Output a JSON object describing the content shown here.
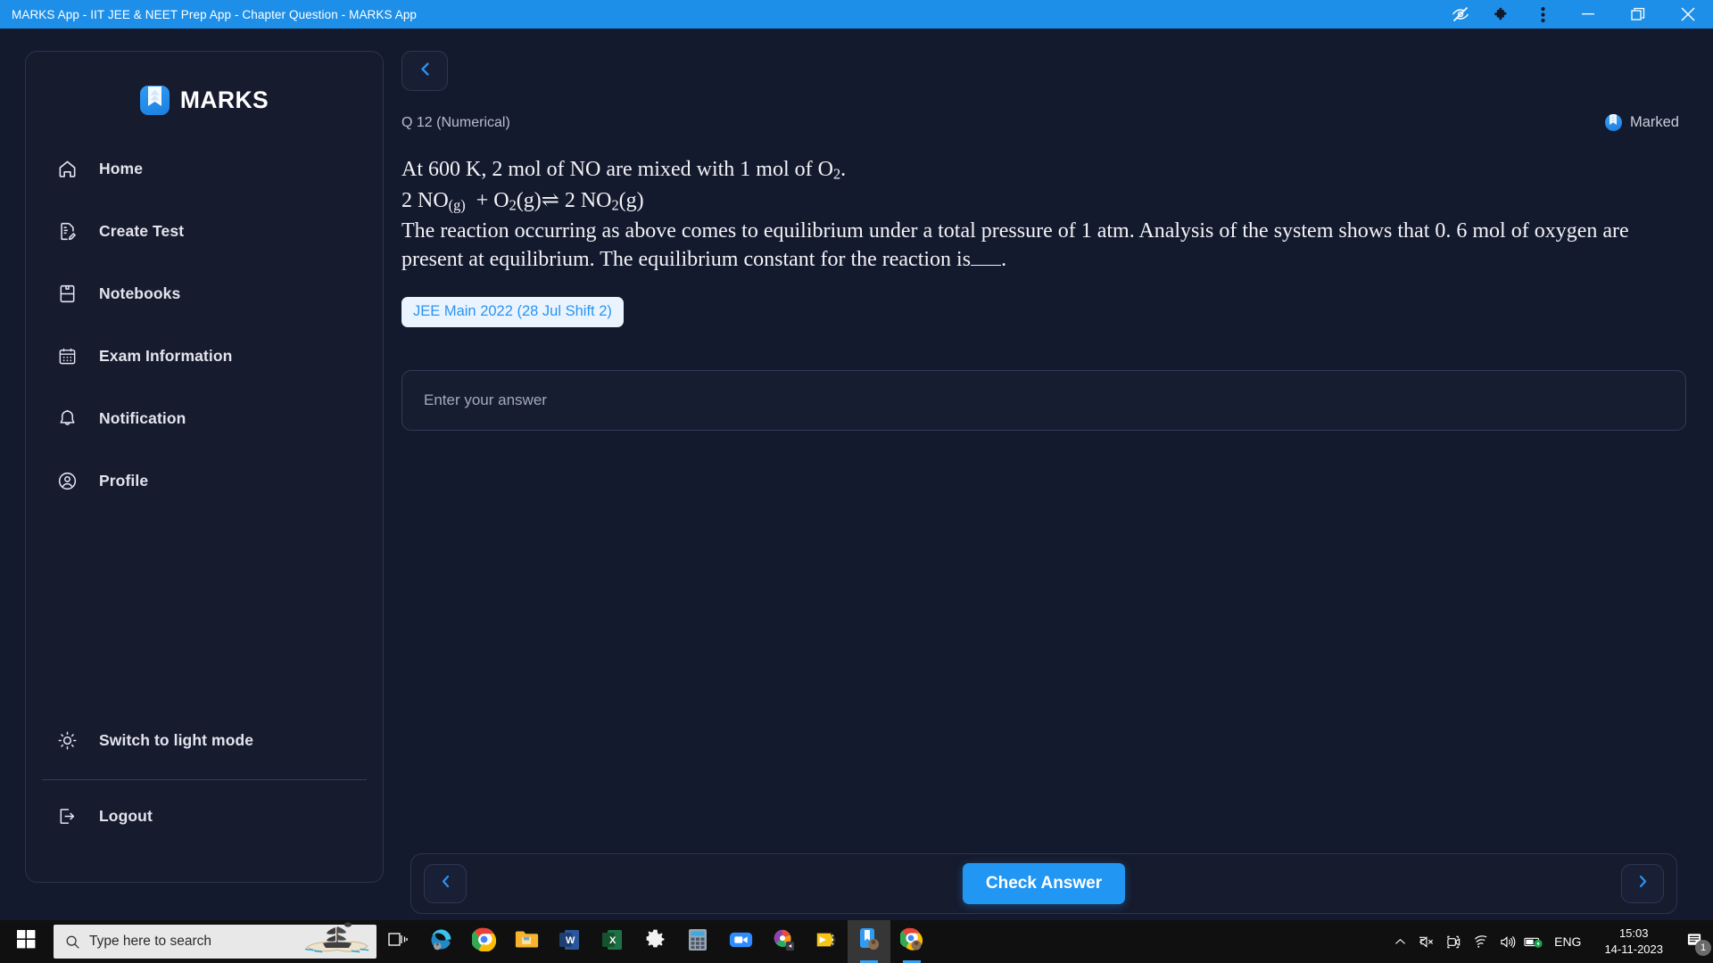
{
  "window": {
    "title": "MARKS App - IIT JEE & NEET Prep App - Chapter Question - MARKS App",
    "controls": {
      "eye_off": "eye-off-icon",
      "extensions": "puzzle-piece-icon",
      "menu": "three-dot-menu-icon",
      "minimize": "minimize-icon",
      "maximize": "maximize-icon",
      "close": "close-icon"
    },
    "accent_color": "#1e8fe8"
  },
  "sidebar": {
    "brand": "MARKS",
    "brand_logo_icon": "bookmark-logo-icon",
    "items": [
      {
        "label": "Home",
        "icon": "home-icon"
      },
      {
        "label": "Create Test",
        "icon": "document-edit-icon"
      },
      {
        "label": "Notebooks",
        "icon": "notebook-icon"
      },
      {
        "label": "Exam Information",
        "icon": "calendar-icon"
      },
      {
        "label": "Notification",
        "icon": "bell-icon"
      },
      {
        "label": "Profile",
        "icon": "user-circle-icon"
      }
    ],
    "theme_toggle": {
      "label": "Switch to light mode",
      "icon": "sun-icon"
    },
    "logout": {
      "label": "Logout",
      "icon": "logout-arrow-icon"
    }
  },
  "main": {
    "back_icon": "chevron-left-icon",
    "question_number": "Q 12 (Numerical)",
    "marked": {
      "label": "Marked",
      "icon": "bookmark-filled-icon"
    },
    "question_lines": [
      "At 600 K, 2  mol of NO are mixed with 1  mol of O",
      "2 NO",
      "The reaction occurring as above comes to equilibrium under a total pressure of 1 atm. Analysis of the system shows that 0. 6  mol of oxygen are present at equilibrium. The equilibrium constant for the reaction is",
      "."
    ],
    "question_text_plain": "At 600 K, 2 mol of NO are mixed with 1 mol of O2. 2 NO(g) + O2(g) ⇌ 2 NO2(g) The reaction occurring as above comes to equilibrium under a total pressure of 1 atm. Analysis of the system shows that 0.6 mol of oxygen are present at equilibrium. The equilibrium constant for the reaction is____.",
    "equation": {
      "coef1": "2",
      "species1": "NO",
      "sub1": "(g)",
      "plus": "+",
      "species2": "O",
      "sub2": "2",
      "state2": "(g)",
      "arrow": "⇌",
      "coef3": "2",
      "species3": "NO",
      "sub3": "2",
      "state3": "(g)"
    },
    "tag": "JEE Main 2022 (28 Jul Shift 2)",
    "answer_placeholder": "Enter your answer",
    "answer_value": ""
  },
  "footer": {
    "prev_icon": "chevron-left-icon",
    "check_label": "Check Answer",
    "next_icon": "chevron-right-icon"
  },
  "taskbar": {
    "start_icon": "windows-start-icon",
    "search_placeholder": "Type here to search",
    "search_icon": "search-icon",
    "task_view_icon": "task-view-icon",
    "apps": [
      {
        "name": "microsoft-edge",
        "running": false
      },
      {
        "name": "google-chrome",
        "running": false
      },
      {
        "name": "file-explorer",
        "running": false
      },
      {
        "name": "microsoft-word",
        "running": false
      },
      {
        "name": "microsoft-excel",
        "running": false
      },
      {
        "name": "settings",
        "running": false
      },
      {
        "name": "calculator",
        "running": false
      },
      {
        "name": "zoom",
        "running": false
      },
      {
        "name": "media-player",
        "running": false
      },
      {
        "name": "video-editor",
        "running": false
      },
      {
        "name": "marks-app",
        "running": true,
        "active": true
      },
      {
        "name": "google-chrome-2",
        "running": true,
        "active": false
      }
    ],
    "tray": {
      "chevron_up": "show-hidden-icons-icon",
      "speaker_mute": "speaker-mute-icon",
      "camera": "camera-icon",
      "wifi": "wifi-icon",
      "volume": "volume-icon",
      "battery": "battery-icon",
      "language": "ENG",
      "time": "15:03",
      "date": "14-11-2023",
      "notification_icon": "action-center-icon",
      "notification_count": "1"
    }
  }
}
